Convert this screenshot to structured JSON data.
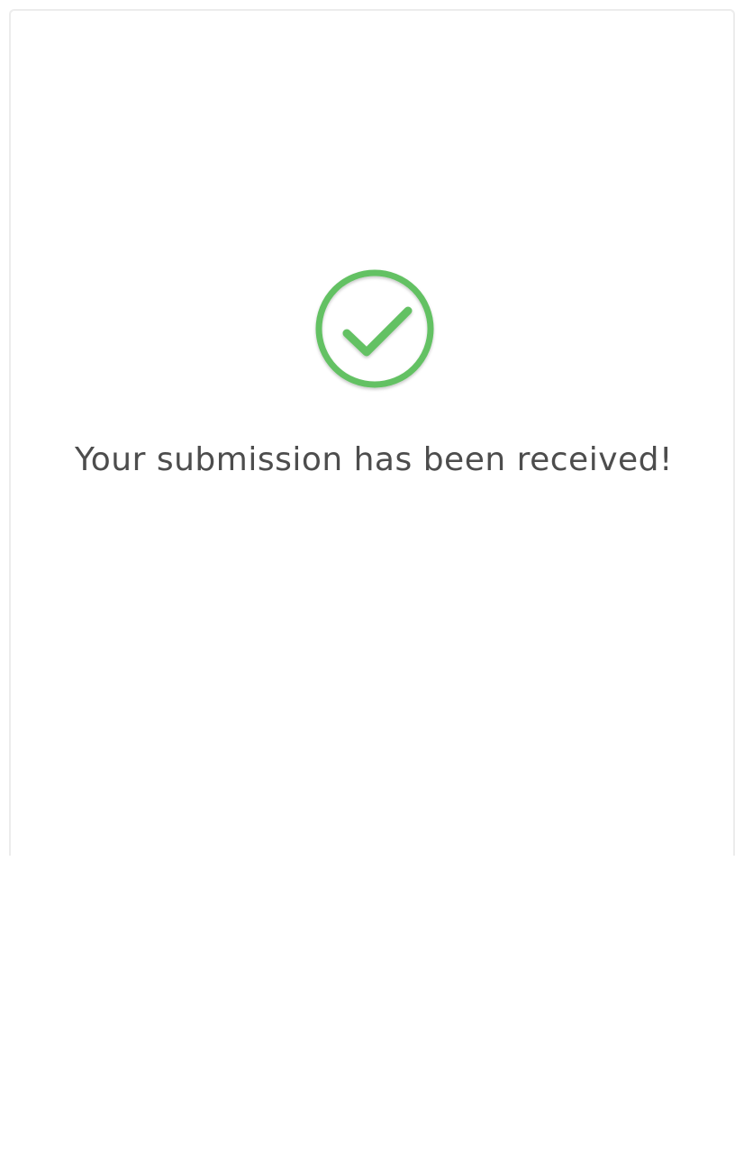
{
  "confirmation": {
    "icon": "check-circle-icon",
    "icon_color": "#63c163",
    "message": "Your submission has been received!",
    "message_color": "#4d4d4d"
  }
}
